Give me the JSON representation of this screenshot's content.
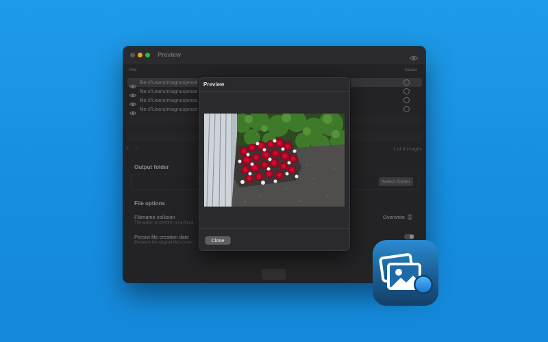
{
  "window": {
    "title": "Preview",
    "columns": {
      "file": "File",
      "status": "Status"
    },
    "files": [
      {
        "path": "file:///Users/magnusjense",
        "selected": true
      },
      {
        "path": "file:///Users/magnusjense",
        "selected": false
      },
      {
        "path": "file:///Users/magnusjense",
        "selected": false
      },
      {
        "path": "file:///Users/magnusjense",
        "selected": false
      }
    ],
    "add_label": "+",
    "remove_label": "−",
    "image_count": "1 of 4 images",
    "output_folder": {
      "title": "Output folder",
      "select_label": "Select folder"
    },
    "file_options": {
      "title": "File options",
      "collision": {
        "title": "Filename collision",
        "desc": "The action to perform on a filena",
        "value": "Overwrite"
      },
      "persist": {
        "title": "Persist file creation date",
        "desc": "Preserve the original file's creati",
        "enabled": true
      }
    }
  },
  "dialog": {
    "title": "Preview",
    "close_label": "Close"
  },
  "icons": {
    "eye": "eye-icon",
    "status": "status-circle-icon",
    "app": "photo-stack-app-icon"
  },
  "colors": {
    "background": "#1a95e4",
    "window": "#232325",
    "dialog": "#2a2a2c",
    "accent": "#1f8fe8"
  }
}
